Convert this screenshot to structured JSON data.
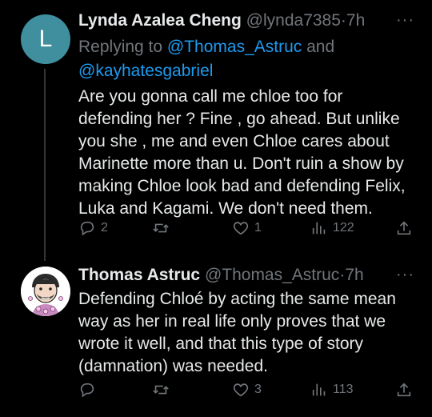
{
  "tweets": [
    {
      "avatar_letter": "L",
      "name": "Lynda Azalea Cheng",
      "handle": "@lynda7385",
      "dot": "·",
      "time": "7h",
      "more": "···",
      "reply_prefix": "Replying to ",
      "reply_mention_1": "@Thomas_Astruc",
      "reply_and": " and",
      "reply_mention_2": "@kayhatesgabriel",
      "text": "Are you gonna call me chloe too for\ndefending her ? Fine , go ahead. But unlike\nyou she , me and even Chloe cares about\nMarinette  more than u. Don't ruin a show by\nmaking Chloe look bad and defending Felix,\nLuka and Kagami.  We don't need them.",
      "replies": "2",
      "retweets": "",
      "likes": "1",
      "views": "122"
    },
    {
      "name": "Thomas Astruc",
      "handle": "@Thomas_Astruc",
      "dot": "·",
      "time": "7h",
      "more": "···",
      "text": "Defending Chloé by acting the same mean\nway as her in real life only proves that we\nwrote it well, and that this type of story\n(damnation) was needed.",
      "replies": "",
      "retweets": "",
      "likes": "3",
      "views": "113"
    }
  ],
  "icons": {
    "reply": "reply-icon",
    "retweet": "retweet-icon",
    "like": "heart-icon",
    "views": "views-icon",
    "share": "share-icon"
  }
}
